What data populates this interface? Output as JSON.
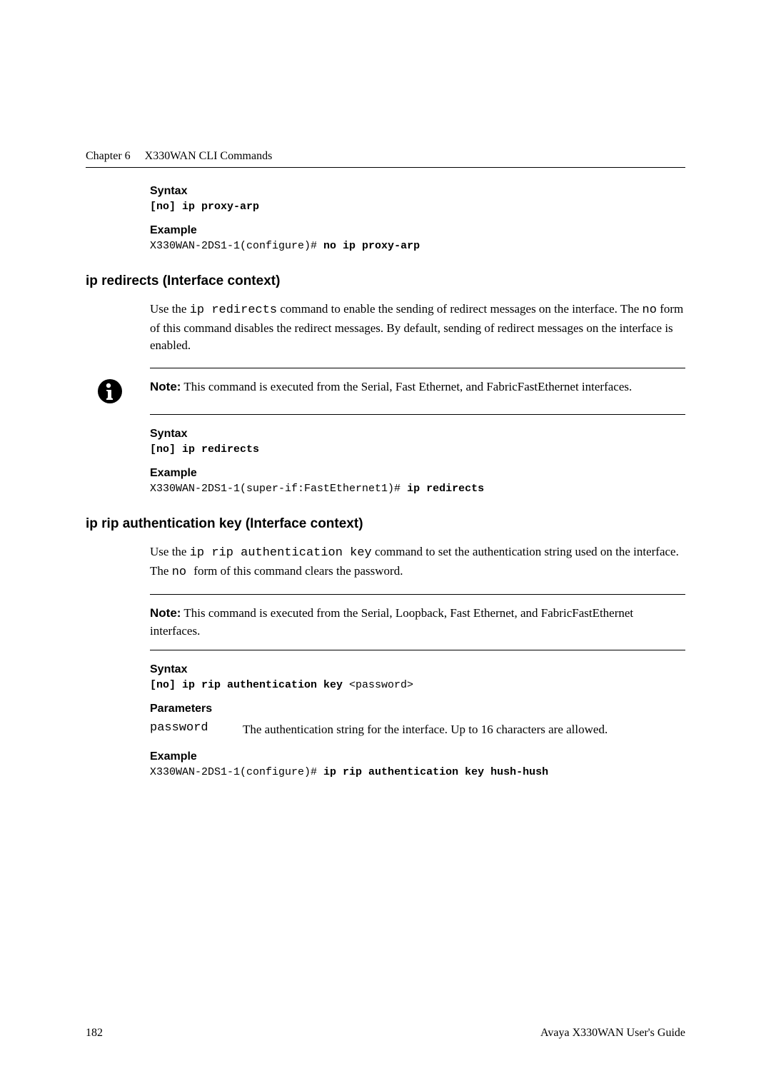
{
  "header": {
    "chapter": "Chapter 6",
    "title": "X330WAN CLI Commands"
  },
  "block1": {
    "syntax_label": "Syntax",
    "syntax_code": "[no] ip proxy-arp",
    "example_label": "Example",
    "example_prefix": "X330WAN-2DS1-1(configure)# ",
    "example_bold": "no ip proxy-arp"
  },
  "section1": {
    "title": "ip redirects (Interface context)",
    "body_pre1": "Use the ",
    "body_code1": "ip redirects",
    "body_mid1": " command to enable the sending of redirect messages on the interface. The ",
    "body_code2": "no",
    "body_post1": " form of this command disables the redirect messages. By default, sending of redirect messages on the interface is enabled.",
    "note_label": "Note:",
    "note_text": "  This command is executed from the Serial, Fast Ethernet, and FabricFastEthernet interfaces.",
    "syntax_label": "Syntax",
    "syntax_code": "[no] ip redirects",
    "example_label": "Example",
    "example_prefix": "X330WAN-2DS1-1(super-if:FastEthernet1)# ",
    "example_bold": "ip redirects"
  },
  "section2": {
    "title": "ip rip authentication key (Interface context)",
    "body_pre1": "Use the ",
    "body_code1": "ip rip authentication key",
    "body_mid1": " command to set the authentication string used on the interface. The ",
    "body_code2": " no ",
    "body_post1": " form of this command clears the password.",
    "note_label": "Note:",
    "note_text": "  This command is executed from the Serial, Loopback, Fast Ethernet, and FabricFastEthernet interfaces.",
    "syntax_label": "Syntax",
    "syntax_bold": "[no] ip rip authentication key ",
    "syntax_param": "<password>",
    "params_label": "Parameters",
    "param_name": "password",
    "param_desc": "The authentication string for the interface. Up to 16 characters are allowed.",
    "example_label": "Example",
    "example_prefix": "X330WAN-2DS1-1(configure)# ",
    "example_bold": "ip rip authentication key hush-hush"
  },
  "footer": {
    "page": "182",
    "text": "Avaya X330WAN User's Guide"
  }
}
